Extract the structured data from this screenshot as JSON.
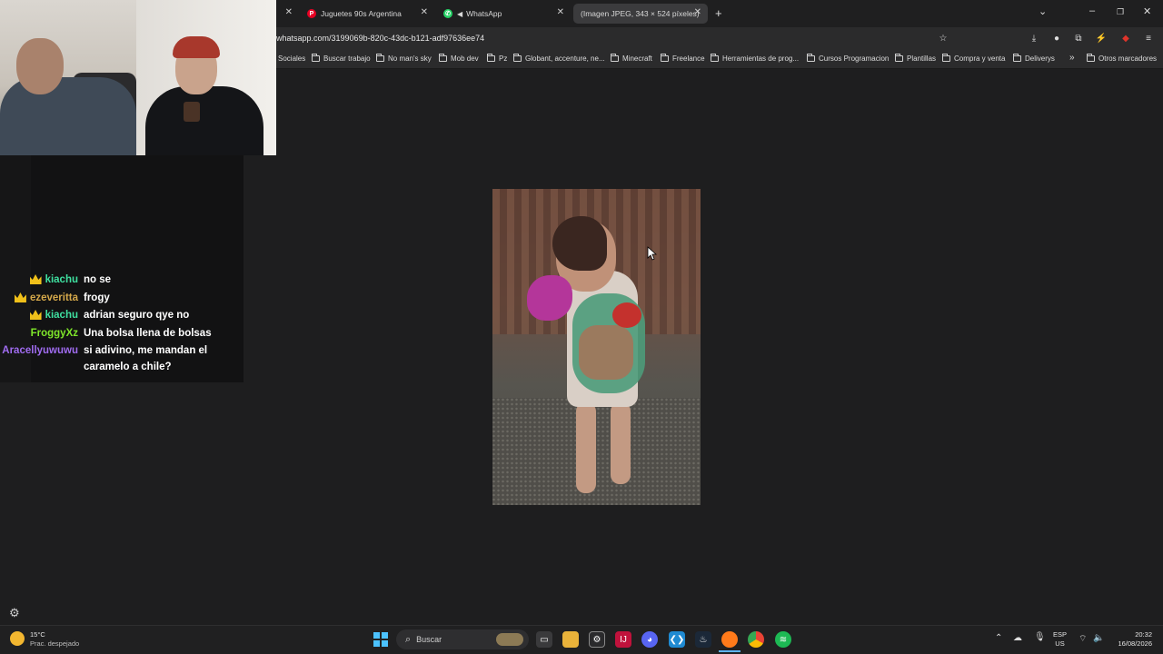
{
  "browser": {
    "tabs": [
      {
        "label": "Juguetes 90s Argentina",
        "icon": "pinterest-icon"
      },
      {
        "label": "WhatsApp",
        "icon": "whatsapp-icon"
      },
      {
        "label": "(Imagen JPEG, 343 × 524 píxeles)",
        "icon": "none"
      }
    ],
    "new_tab": "+",
    "url": "whatsapp.com/3199069b-820c-43dc-b121-adf97636ee74",
    "bookmarks": [
      "Sociales",
      "Buscar trabajo",
      "No man's sky",
      "Mob dev",
      "Pz",
      "Globant, accenture, ne...",
      "Minecraft",
      "Freelance",
      "Herramientas de prog...",
      "Cursos Programacion",
      "Plantillas",
      "Compra y venta",
      "Deliverys"
    ],
    "bookmarks_more": "»",
    "other_bookmarks": "Otros marcadores"
  },
  "chat": [
    {
      "name": "kiachu",
      "color": "#3fe0a0",
      "badge": true,
      "message": "no se"
    },
    {
      "name": "ezeveritta",
      "color": "#d4a84a",
      "badge": true,
      "message": "frogy"
    },
    {
      "name": "kiachu",
      "color": "#3fe0a0",
      "badge": true,
      "message": "adrian seguro qye no"
    },
    {
      "name": "FroggyXz",
      "color": "#7ee52a",
      "badge": false,
      "message": "Una bolsa llena de bolsas"
    },
    {
      "name": "Aracellyuwuwu",
      "color": "#a06cf0",
      "badge": false,
      "message": "si adivino, me mandan el caramelo a chile?"
    }
  ],
  "taskbar": {
    "weather_temp": "15°C",
    "weather_desc": "Prac. despejado",
    "search_placeholder": "Buscar",
    "lang_top": "ESP",
    "lang_bottom": "US",
    "time": "20:32",
    "date": "16/08/2026"
  }
}
